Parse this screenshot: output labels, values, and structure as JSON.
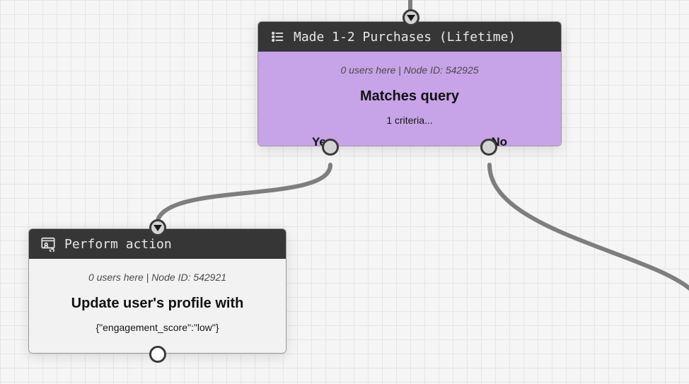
{
  "nodeA": {
    "title": "Made 1-2 Purchases (Lifetime)",
    "meta": "0 users here | Node ID: 542925",
    "main": "Matches query",
    "sub": "1 criteria...",
    "yesLabel": "Yes",
    "noLabel": "No"
  },
  "nodeB": {
    "title": "Perform action",
    "meta": "0 users here | Node ID: 542921",
    "main": "Update user's profile with",
    "sub": "{\"engagement_score\":\"low\"}"
  }
}
